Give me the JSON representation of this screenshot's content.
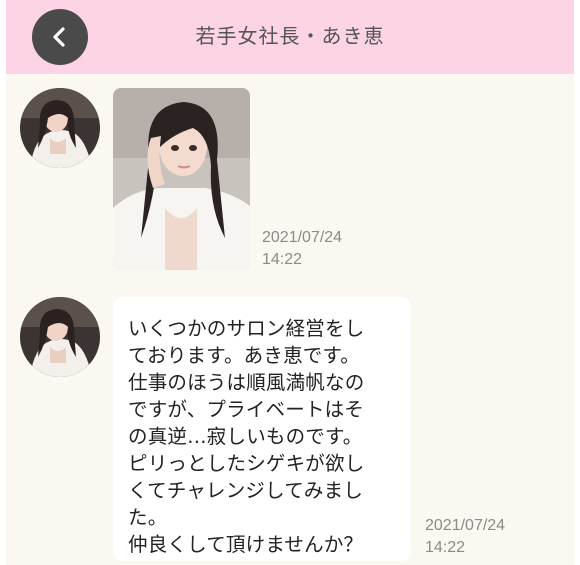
{
  "header": {
    "title": "若手女社長・あき恵",
    "bg_color": "#fdd3e6",
    "back_icon": "chevron-left-icon"
  },
  "messages": [
    {
      "type": "image",
      "timestamp_date": "2021/07/24",
      "timestamp_time": "14:22"
    },
    {
      "type": "text",
      "lines": [
        "いくつかのサロン経営をし",
        "ております。あき恵です。",
        "仕事のほうは順風満帆なの",
        "ですが、プライベートはそ",
        "の真逆…寂しいものです。",
        "ピリっとしたシゲキが欲し",
        "くてチャレンジしてみまし",
        "た。",
        "仲良くして頂けませんか？"
      ],
      "timestamp_date": "2021/07/24",
      "timestamp_time": "14:22"
    }
  ],
  "colors": {
    "screen_bg": "#fbf8f1",
    "bubble_bg": "#ffffff",
    "back_button": "#4a4a4a"
  }
}
